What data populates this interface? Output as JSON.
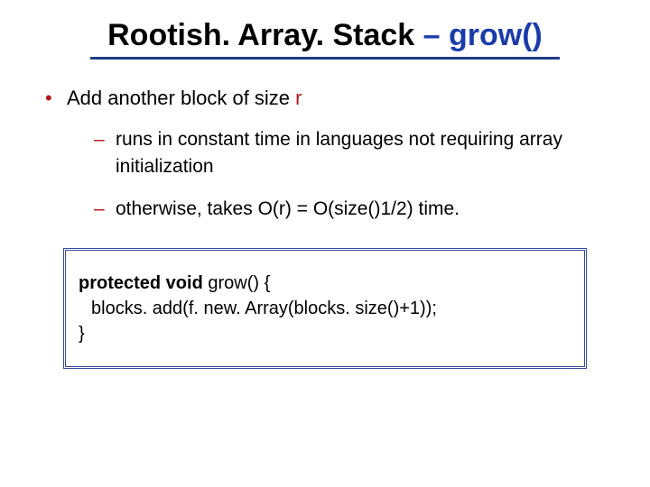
{
  "title": {
    "part1_black": "Rootish. Array. Stack ",
    "part2_blue": "– grow()"
  },
  "bullets": {
    "main_prefix": "Add another block of size ",
    "main_var": "r",
    "sub": [
      "runs in constant time in languages not requiring array initialization",
      "otherwise, takes O(r) = O(size()1/2) time."
    ]
  },
  "code": {
    "kw1": "protected void",
    "line1_rest": " grow() {",
    "line2": "blocks. add(f. new. Array(blocks. size()+1));",
    "line3": "}"
  }
}
